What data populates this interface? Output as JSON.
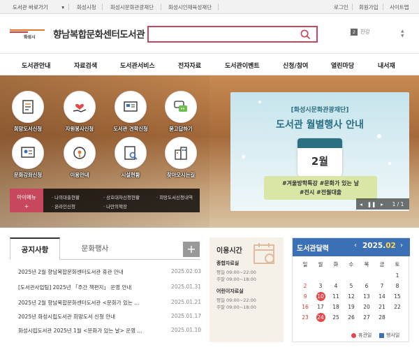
{
  "topbar": {
    "site_select": "도서관 바로가기",
    "links": [
      "화성시청",
      "화성시문화관광재단",
      "화성시인재육성재단"
    ],
    "right_links": [
      "로그인",
      "회원가입",
      "사이트맵"
    ]
  },
  "header": {
    "logo_text": "화성시",
    "title": "향남복합문화센터도서관",
    "search_placeholder": "",
    "lang_num": "2",
    "lang_label": "한강"
  },
  "nav": [
    "도서관안내",
    "자료검색",
    "도서관서비스",
    "전자자료",
    "도서관이벤트",
    "신청/참여",
    "열린마당",
    "내서재"
  ],
  "services": [
    {
      "label": "희망도서신청",
      "icon": "wish-book-icon"
    },
    {
      "label": "자원봉사신청",
      "icon": "volunteer-icon"
    },
    {
      "label": "도서관 견학신청",
      "icon": "tour-icon"
    },
    {
      "label": "묻고답하기",
      "icon": "qna-icon"
    },
    {
      "label": "문화강좌신청",
      "icon": "lecture-icon"
    },
    {
      "label": "이용안내",
      "icon": "guide-icon"
    },
    {
      "label": "시설현황",
      "icon": "facility-icon"
    },
    {
      "label": "찾아오시는길",
      "icon": "directions-icon"
    }
  ],
  "mymenu": {
    "tag": "마이메뉴",
    "plus": "+",
    "links": [
      "나의대출현황",
      "상호대차신청현황",
      "희망도서신청내역",
      "온라인신청",
      "나만의책장"
    ]
  },
  "banner": {
    "sub": "[화성시문화관광재단]",
    "main": "도서관 월별행사 안내",
    "month": "2월",
    "tags_line1": "#겨울방학특강 #문화가 있는 날",
    "tags_line2": "#전시 #전월대출",
    "pager": "1 / 1"
  },
  "tabs": {
    "active": "공지사항",
    "inactive": "문화행사",
    "more": "+"
  },
  "notices": [
    {
      "title": "2025년 2월 향남복합문화센터도서관 휴관 안내",
      "date": "2025.02.03"
    },
    {
      "title": "[도서관사업팀] 2025년 「주간 책편지」 운영 안내",
      "date": "2025.01.31"
    },
    {
      "title": "2025년 2월 향남복합문화센터도서관 <문화가 있는 ...",
      "date": "2025.01.21"
    },
    {
      "title": "2025년 화성시립도서관 희망도서 신청 안내",
      "date": "2025.01.17"
    },
    {
      "title": "화성시립도서관 2025년 1월 <문화가 있는 날> 운영 ...",
      "date": "2025.01.10"
    }
  ],
  "hours": {
    "title": "이용시간",
    "sections": [
      {
        "name": "종합자료실",
        "rows": [
          "평일 09:00~22:00",
          "주말 09:00~18:00"
        ]
      },
      {
        "name": "어린이자료실",
        "rows": [
          "평일 09:00~22:00",
          "주말 09:00~18:00"
        ]
      }
    ]
  },
  "calendar": {
    "title": "도서관달력",
    "prev": "‹",
    "next": "›",
    "year": "2025.",
    "month": "02",
    "weekdays": [
      "일",
      "월",
      "화",
      "수",
      "목",
      "금",
      "토"
    ],
    "weeks": [
      [
        "",
        "",
        "",
        "",
        "",
        "",
        "1"
      ],
      [
        "2",
        "3",
        "4",
        "5",
        "6",
        "7",
        "8"
      ],
      [
        "9",
        "10",
        "11",
        "12",
        "13",
        "14",
        "15"
      ],
      [
        "16",
        "17",
        "18",
        "19",
        "20",
        "21",
        "22"
      ],
      [
        "23",
        "24",
        "25",
        "26",
        "27",
        "28",
        ""
      ]
    ],
    "holidays": [
      "10",
      "24"
    ],
    "legend_closed": "휴관일",
    "legend_event": "행사일"
  },
  "colors": {
    "accent": "#c6475e",
    "calendar_blue": "#3b6fb6",
    "holiday_red": "#e54848"
  }
}
